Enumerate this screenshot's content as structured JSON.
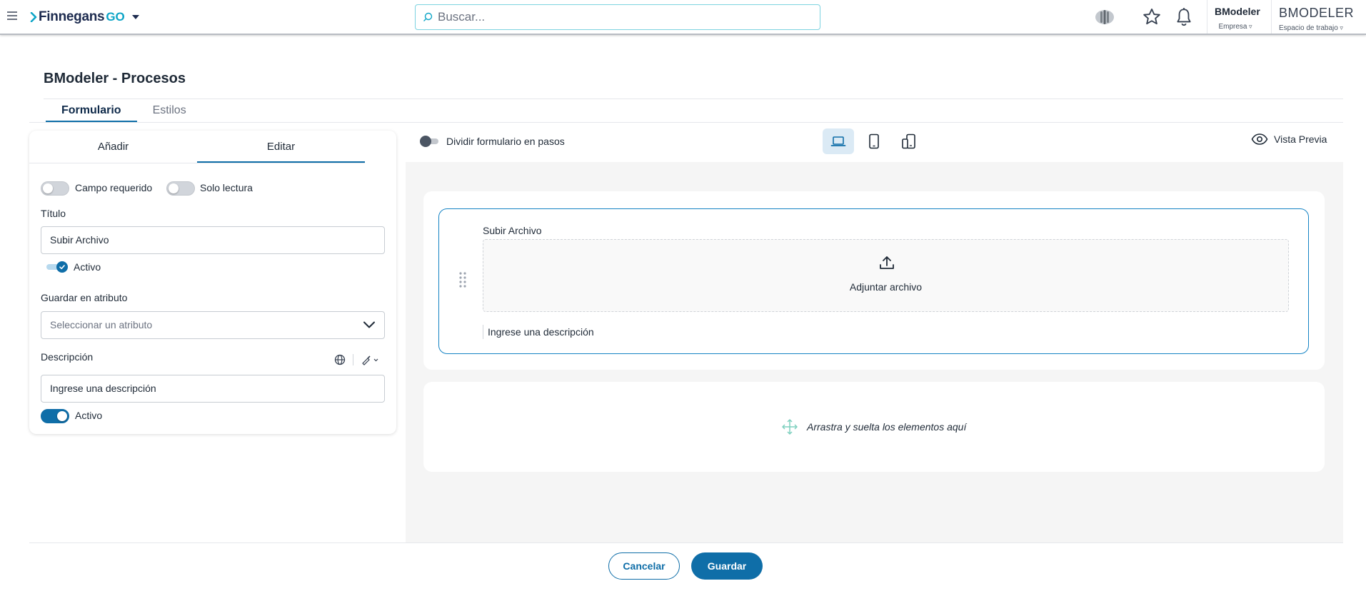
{
  "topbar": {
    "brand": "Finnegans",
    "brand_suffix": "GO",
    "search_placeholder": "Buscar...",
    "company_name": "BModeler",
    "company_label": "Empresa",
    "workspace_name": "BMODELER",
    "workspace_label": "Espacio de trabajo"
  },
  "page": {
    "title": "BModeler - Procesos",
    "tabs": [
      {
        "label": "Formulario",
        "active": true
      },
      {
        "label": "Estilos",
        "active": false
      }
    ]
  },
  "editor_panel": {
    "tabs": [
      {
        "label": "Añadir",
        "active": false
      },
      {
        "label": "Editar",
        "active": true
      }
    ],
    "required_label": "Campo requerido",
    "readonly_label": "Solo lectura",
    "title_label": "Título",
    "title_value": "Subir Archivo",
    "title_active_label": "Activo",
    "attribute_label": "Guardar en atributo",
    "attribute_placeholder": "Seleccionar un atributo",
    "description_label": "Descripción",
    "description_value": "Ingrese una descripción",
    "description_active_label": "Activo"
  },
  "canvas_toolbar": {
    "split_steps_label": "Dividir formulario en pasos",
    "devices": [
      "laptop-icon",
      "tablet-icon",
      "mobile-rotate-icon"
    ],
    "active_device": "laptop-icon",
    "preview_label": "Vista Previa"
  },
  "form_canvas": {
    "element_title": "Subir Archivo",
    "upload_label": "Adjuntar archivo",
    "element_description": "Ingrese una descripción",
    "drop_hint": "Arrastra y suelta los elementos aquí"
  },
  "footer": {
    "cancel_label": "Cancelar",
    "save_label": "Guardar"
  },
  "colors": {
    "primary": "#0f6ea8",
    "brand_go": "#0ea5c7",
    "canvas_bg": "#f5f5f5",
    "selected_border": "#1583c4"
  }
}
